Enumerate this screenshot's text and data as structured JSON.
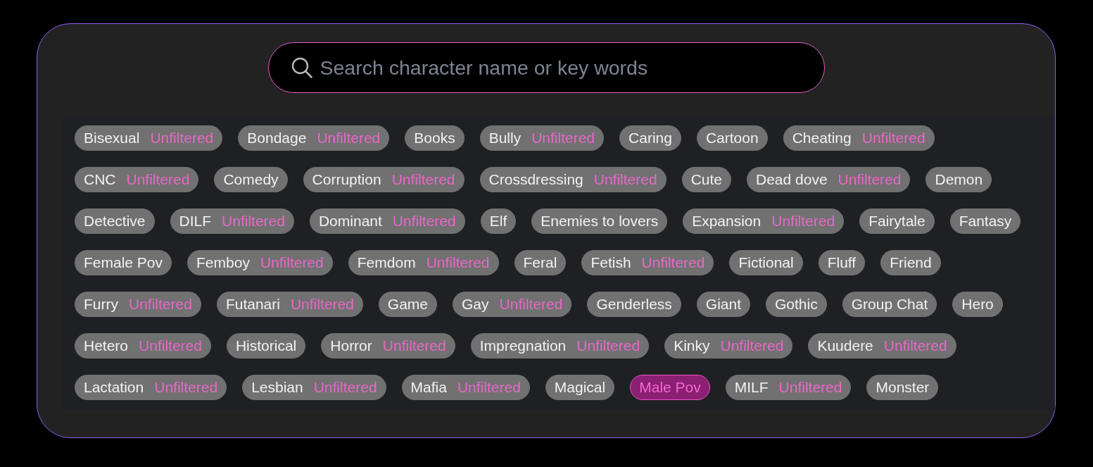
{
  "search": {
    "placeholder": "Search character name or key words"
  },
  "tags": [
    {
      "label": "Bisexual",
      "badge": "Unfiltered",
      "selected": false
    },
    {
      "label": "Bondage",
      "badge": "Unfiltered",
      "selected": false
    },
    {
      "label": "Books",
      "selected": false
    },
    {
      "label": "Bully",
      "badge": "Unfiltered",
      "selected": false
    },
    {
      "label": "Caring",
      "selected": false
    },
    {
      "label": "Cartoon",
      "selected": false
    },
    {
      "label": "Cheating",
      "badge": "Unfiltered",
      "selected": false
    },
    {
      "label": "CNC",
      "badge": "Unfiltered",
      "selected": false
    },
    {
      "label": "Comedy",
      "selected": false
    },
    {
      "label": "Corruption",
      "badge": "Unfiltered",
      "selected": false
    },
    {
      "label": "Crossdressing",
      "badge": "Unfiltered",
      "selected": false
    },
    {
      "label": "Cute",
      "selected": false
    },
    {
      "label": "Dead dove",
      "badge": "Unfiltered",
      "selected": false
    },
    {
      "label": "Demon",
      "selected": false
    },
    {
      "label": "Detective",
      "selected": false
    },
    {
      "label": "DILF",
      "badge": "Unfiltered",
      "selected": false
    },
    {
      "label": "Dominant",
      "badge": "Unfiltered",
      "selected": false
    },
    {
      "label": "Elf",
      "selected": false
    },
    {
      "label": "Enemies to lovers",
      "selected": false
    },
    {
      "label": "Expansion",
      "badge": "Unfiltered",
      "selected": false
    },
    {
      "label": "Fairytale",
      "selected": false
    },
    {
      "label": "Fantasy",
      "selected": false
    },
    {
      "label": "Female Pov",
      "selected": false
    },
    {
      "label": "Femboy",
      "badge": "Unfiltered",
      "selected": false
    },
    {
      "label": "Femdom",
      "badge": "Unfiltered",
      "selected": false
    },
    {
      "label": "Feral",
      "selected": false
    },
    {
      "label": "Fetish",
      "badge": "Unfiltered",
      "selected": false
    },
    {
      "label": "Fictional",
      "selected": false
    },
    {
      "label": "Fluff",
      "selected": false
    },
    {
      "label": "Friend",
      "selected": false
    },
    {
      "label": "Furry",
      "badge": "Unfiltered",
      "selected": false
    },
    {
      "label": "Futanari",
      "badge": "Unfiltered",
      "selected": false
    },
    {
      "label": "Game",
      "selected": false
    },
    {
      "label": "Gay",
      "badge": "Unfiltered",
      "selected": false
    },
    {
      "label": "Genderless",
      "selected": false
    },
    {
      "label": "Giant",
      "selected": false
    },
    {
      "label": "Gothic",
      "selected": false
    },
    {
      "label": "Group Chat",
      "selected": false
    },
    {
      "label": "Hero",
      "selected": false
    },
    {
      "label": "Hetero",
      "badge": "Unfiltered",
      "selected": false
    },
    {
      "label": "Historical",
      "selected": false
    },
    {
      "label": "Horror",
      "badge": "Unfiltered",
      "selected": false
    },
    {
      "label": "Impregnation",
      "badge": "Unfiltered",
      "selected": false
    },
    {
      "label": "Kinky",
      "badge": "Unfiltered",
      "selected": false
    },
    {
      "label": "Kuudere",
      "badge": "Unfiltered",
      "selected": false
    },
    {
      "label": "Lactation",
      "badge": "Unfiltered",
      "selected": false
    },
    {
      "label": "Lesbian",
      "badge": "Unfiltered",
      "selected": false
    },
    {
      "label": "Mafia",
      "badge": "Unfiltered",
      "selected": false
    },
    {
      "label": "Magical",
      "selected": false
    },
    {
      "label": "Male Pov",
      "selected": true
    },
    {
      "label": "MILF",
      "badge": "Unfiltered",
      "selected": false
    },
    {
      "label": "Monster",
      "selected": false
    }
  ]
}
